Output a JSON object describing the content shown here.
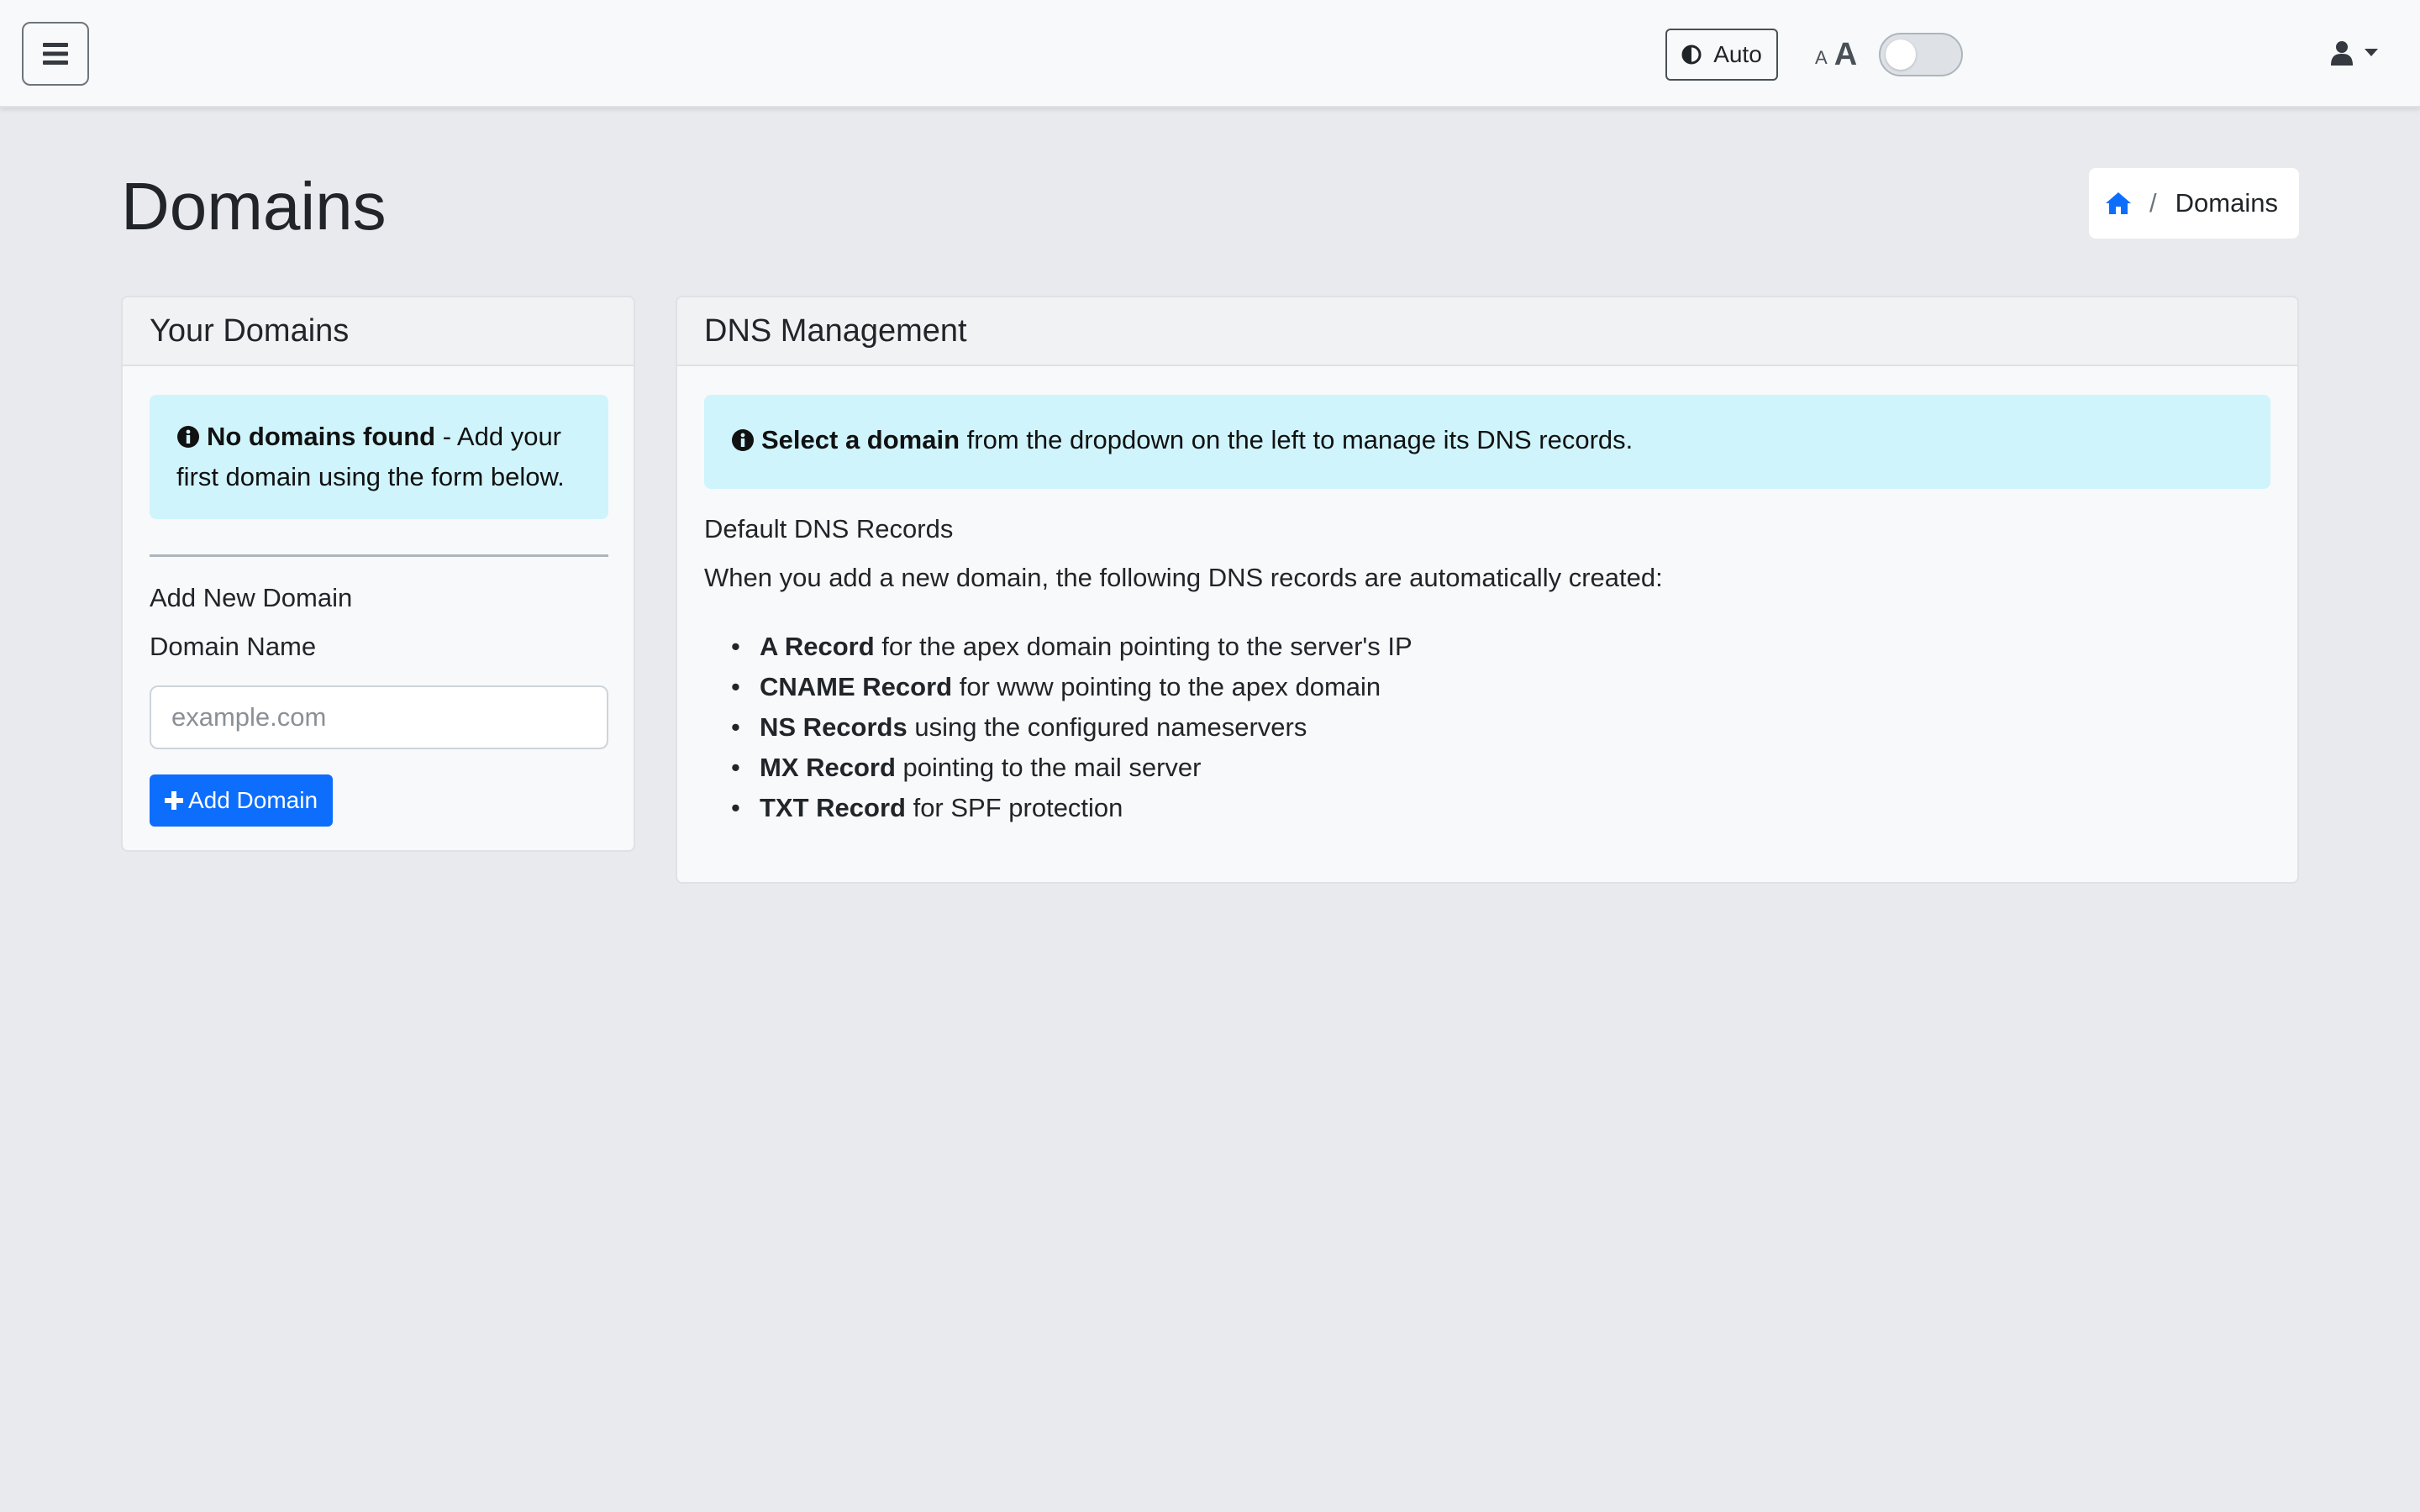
{
  "navbar": {
    "theme_label": "Auto",
    "font_small": "A",
    "font_large": "A",
    "dark_mode_toggle": false
  },
  "page": {
    "title": "Domains"
  },
  "breadcrumb": {
    "separator": "/",
    "current": "Domains"
  },
  "domains_card": {
    "header": "Your Domains",
    "alert_strong": "No domains found",
    "alert_text": " - Add your first domain using the form below.",
    "form_title": "Add New Domain",
    "field_label": "Domain Name",
    "field_value": "",
    "field_placeholder": "example.com",
    "submit_label": "Add Domain"
  },
  "dns_card": {
    "header": "DNS Management",
    "alert_strong": "Select a domain",
    "alert_text": " from the dropdown on the left to manage its DNS records.",
    "default_title": "Default DNS Records",
    "intro": "When you add a new domain, the following DNS records are automatically created:",
    "records": [
      {
        "name": "A Record",
        "desc": " for the apex domain pointing to the server's IP"
      },
      {
        "name": "CNAME Record",
        "desc": " for www pointing to the apex domain"
      },
      {
        "name": "NS Records",
        "desc": " using the configured nameservers"
      },
      {
        "name": "MX Record",
        "desc": " pointing to the mail server"
      },
      {
        "name": "TXT Record",
        "desc": " for SPF protection"
      }
    ]
  },
  "colors": {
    "accent": "#0d6efd",
    "info_alert_bg": "#cff4fc",
    "page_bg": "#e9eaee"
  },
  "icons": {
    "menu": "hamburger-icon",
    "theme": "half-circle-contrast-icon",
    "home": "home-icon",
    "user": "user-icon",
    "info": "info-circle-icon",
    "add": "plus-icon"
  }
}
